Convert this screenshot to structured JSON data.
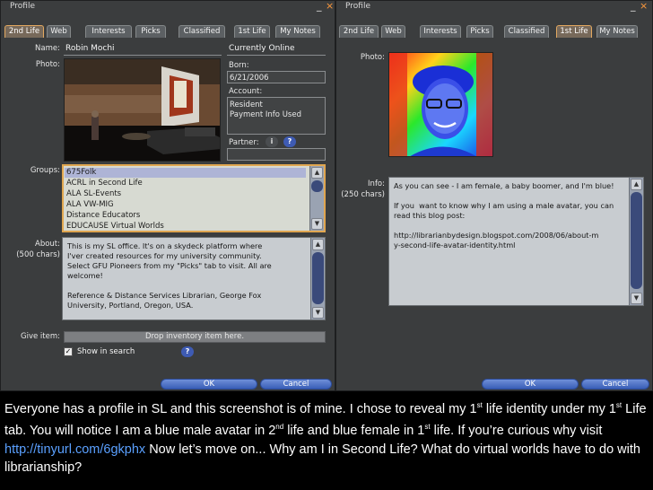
{
  "left_window": {
    "title": "Profile",
    "controls": {
      "minimize": "_",
      "close": "×"
    },
    "tabs": [
      "2nd Life",
      "Web",
      "Interests",
      "Picks",
      "Classified",
      "1st Life",
      "My Notes"
    ],
    "active_tab": "2nd Life",
    "name_label": "Name:",
    "name_value": "Robin Mochi",
    "photo_label": "Photo:",
    "online_status": "Currently Online",
    "born_label": "Born:",
    "born_value": "6/21/2006",
    "account_label": "Account:",
    "account_line1": "Resident",
    "account_line2": "Payment Info Used",
    "partner_label": "Partner:",
    "partner_info_btn": "i",
    "partner_help_btn": "?",
    "groups_label": "Groups:",
    "groups": [
      "675Folk",
      "ACRL in Second Life",
      "ALA SL-Events",
      "ALA VW-MIG",
      "Distance Educators",
      "EDUCAUSE Virtual Worlds"
    ],
    "selected_group": "675Folk",
    "about_label": "About:",
    "about_chars": "(500 chars)",
    "about_text": "This is my SL office. It's on a skydeck platform where\nI'ver created resources for my university community.\nSelect GFU Pioneers from my \"Picks\" tab to visit. All are\nwelcome!\n\nReference & Distance Services Librarian, George Fox\nUniversity, Portland, Oregon, USA.",
    "give_item_label": "Give item:",
    "give_item_placeholder": "Drop inventory item here.",
    "show_in_search_label": "Show in search",
    "show_in_search_checked": true,
    "show_in_search_help": "?",
    "ok_label": "OK",
    "cancel_label": "Cancel"
  },
  "right_window": {
    "title": "Profile",
    "controls": {
      "minimize": "_",
      "close": "×"
    },
    "tabs": [
      "2nd Life",
      "Web",
      "Interests",
      "Picks",
      "Classified",
      "1st Life",
      "My Notes"
    ],
    "active_tab": "1st Life",
    "photo_label": "Photo:",
    "info_label": "Info:",
    "info_chars": "(250 chars)",
    "info_text": "As you can see - I am female, a baby boomer, and I'm blue!\n\nIf you  want to know why I am using a male avatar, you can\nread this blog post:\n\nhttp://librarianbydesign.blogspot.com/2008/06/about-m\ny-second-life-avatar-identity.html",
    "ok_label": "OK",
    "cancel_label": "Cancel"
  },
  "caption": {
    "part1": " Everyone has a profile in SL and this screenshot is of mine. I chose to reveal my 1",
    "sup1": "st",
    "part2": " life identity under my 1",
    "sup2": "st",
    "part3": " Life tab. You will notice I am a blue male avatar in 2",
    "sup3": "nd",
    "part4": " life and blue female in 1",
    "sup4": "st",
    "part5": " life. If you’re curious why visit ",
    "link": "http://tinyurl.com/6gkphx",
    "part6": " Now let’s move on... Why am I in Second Life?  What do virtual worlds have to do with librarianship?"
  },
  "colors": {
    "panel_bg": "#3b3d3e",
    "active_tab_border": "#e2a860",
    "button_blue": "#3a5fb7",
    "link": "#5aa0ff"
  }
}
